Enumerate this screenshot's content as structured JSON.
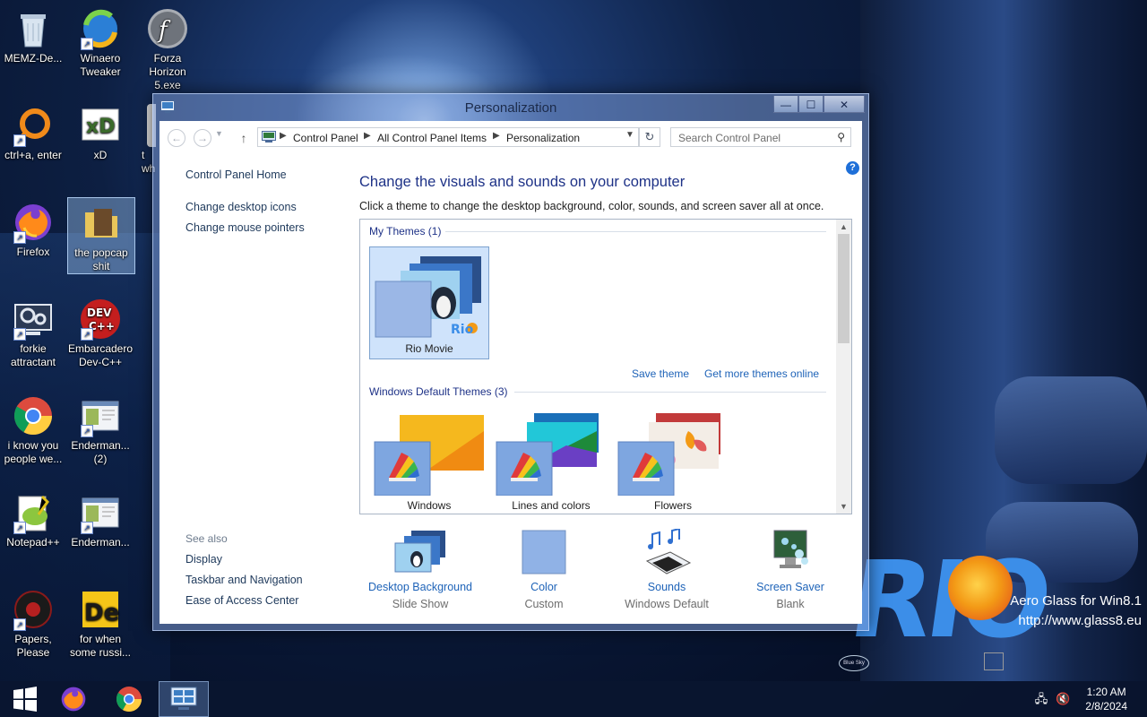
{
  "desktop": {
    "icons": [
      {
        "label": "MEMZ-De...",
        "name": "recycle-bin"
      },
      {
        "label": "Winaero Tweaker",
        "name": "winaero-tweaker"
      },
      {
        "label": "Forza Horizon 5.exe",
        "name": "forza-horizon"
      },
      {
        "label": "ctrl+a, enter",
        "name": "ctrl-a-enter"
      },
      {
        "label": "xD",
        "name": "xd"
      },
      {
        "label": "t wh",
        "name": "partial-icon"
      },
      {
        "label": "Firefox",
        "name": "firefox"
      },
      {
        "label": "the popcap shit",
        "name": "popcap-folder"
      },
      {
        "label": "forkie attractant",
        "name": "forkie-attractant"
      },
      {
        "label": "Embarcadero Dev-C++",
        "name": "dev-cpp"
      },
      {
        "label": "i know you people we...",
        "name": "chrome-shortcut"
      },
      {
        "label": "Enderman... (2)",
        "name": "enderman-2"
      },
      {
        "label": "Notepad++",
        "name": "notepad-plus-plus"
      },
      {
        "label": "Enderman...",
        "name": "enderman"
      },
      {
        "label": "Papers, Please",
        "name": "papers-please"
      },
      {
        "label": "for when some russi...",
        "name": "for-when-some-russi"
      }
    ],
    "dev_logo_text": "DEV\nC++",
    "de_logo_text": "De",
    "watermark_line1": "Aero Glass for Win8.1",
    "watermark_line2": "http://www.glass8.eu",
    "rio_text": "RIO",
    "blue_sky_text": "Blue Sky"
  },
  "window": {
    "title": "Personalization",
    "controls": {
      "minimize": "—",
      "maximize": "☐",
      "close": "✕"
    },
    "nav": {
      "back": "←",
      "forward": "→",
      "up": "↑",
      "refresh": "↻"
    },
    "breadcrumb": [
      "Control Panel",
      "All Control Panel Items",
      "Personalization"
    ],
    "search_placeholder": "Search Control Panel",
    "help": "?",
    "left_links": [
      "Control Panel Home",
      "Change desktop icons",
      "Change mouse pointers"
    ],
    "see_also_label": "See also",
    "see_also": [
      "Display",
      "Taskbar and Navigation",
      "Ease of Access Center"
    ],
    "heading": "Change the visuals and sounds on your computer",
    "subtext": "Click a theme to change the desktop background, color, sounds, and screen saver all at once.",
    "my_themes_header": "My Themes (1)",
    "my_themes": [
      {
        "label": "Rio Movie",
        "selected": true
      }
    ],
    "save_theme": "Save theme",
    "get_more": "Get more themes online",
    "default_themes_header": "Windows Default Themes (3)",
    "default_themes": [
      {
        "label": "Windows"
      },
      {
        "label": "Lines and colors"
      },
      {
        "label": "Flowers"
      }
    ],
    "settings": [
      {
        "title": "Desktop Background",
        "sub": "Slide Show"
      },
      {
        "title": "Color",
        "sub": "Custom"
      },
      {
        "title": "Sounds",
        "sub": "Windows Default"
      },
      {
        "title": "Screen Saver",
        "sub": "Blank"
      }
    ]
  },
  "taskbar": {
    "time": "1:20 AM",
    "date": "2/8/2024"
  }
}
